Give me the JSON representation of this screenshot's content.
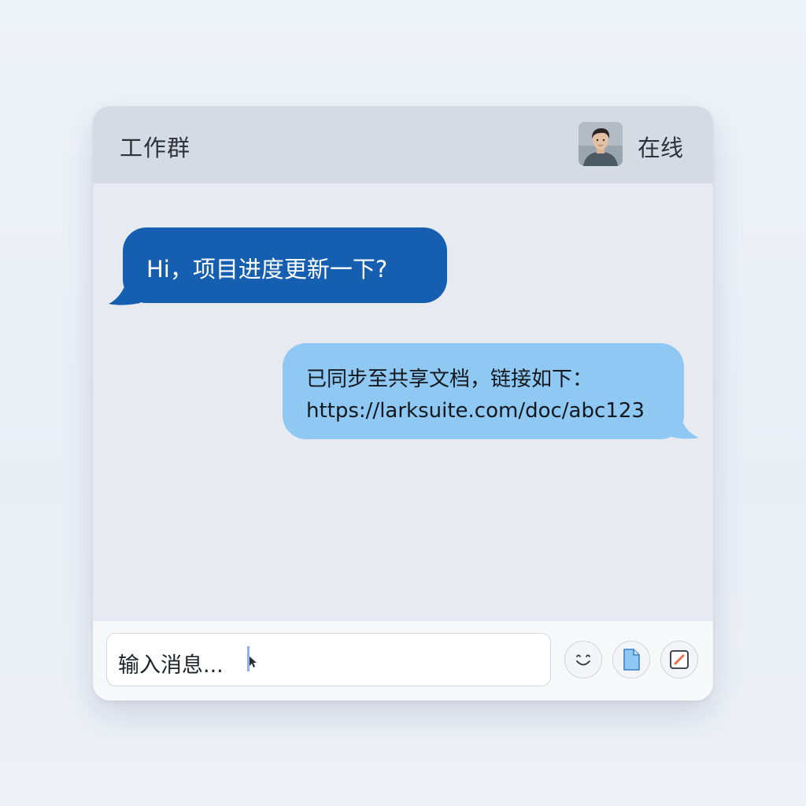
{
  "header": {
    "title": "工作群",
    "status": "在线",
    "avatar_icon": "user-avatar-photo"
  },
  "messages": [
    {
      "direction": "incoming",
      "text": "Hi，项目进度更新一下?",
      "color": "#165fb0"
    },
    {
      "direction": "outgoing",
      "lines": [
        "已同步至共享文档，链接如下：",
        "https://larksuite.com/doc/abc123"
      ],
      "color": "#8ec8f3"
    }
  ],
  "composer": {
    "placeholder": "输入消息...",
    "tools": [
      {
        "name": "emoji",
        "icon": "smiley-icon"
      },
      {
        "name": "file",
        "icon": "document-icon"
      },
      {
        "name": "edit",
        "icon": "edit-icon"
      }
    ]
  },
  "colors": {
    "header_bg": "#d5dbe3",
    "chat_bg": "#e7eaf0",
    "accent": "#165fb0"
  }
}
